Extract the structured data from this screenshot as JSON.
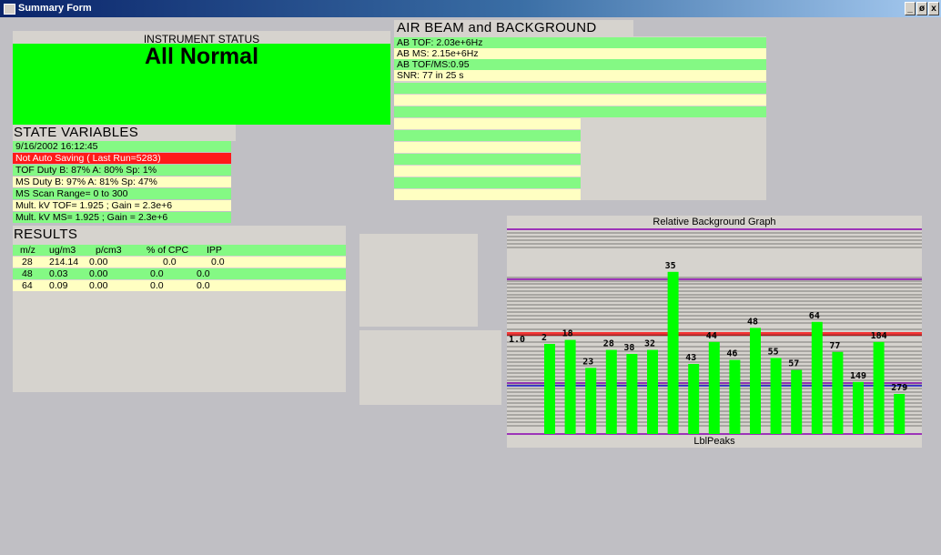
{
  "window": {
    "title": "Summary Form",
    "controls": [
      "_",
      "ø",
      "x"
    ]
  },
  "instrument_status": {
    "heading": "INSTRUMENT STATUS",
    "value": "All Normal",
    "color": "#00ff00"
  },
  "state_variables": {
    "heading": "STATE VARIABLES",
    "rows": [
      "9/16/2002 16:12:45",
      "Not Auto Saving ( Last Run=5283)",
      "TOF Duty B: 87% A: 80% Sp: 1%",
      "MS Duty B:  97% A: 81% Sp: 47%",
      "MS Scan Range= 0 to 300",
      "Mult. kV TOF= 1.925 ; Gain = 2.3e+6",
      "Mult. kV MS= 1.925 ; Gain = 2.3e+6"
    ]
  },
  "results": {
    "heading": "RESULTS",
    "columns": [
      "m/z",
      "ug/m3",
      "p/cm3",
      "% of CPC",
      "IPP"
    ],
    "rows": [
      [
        "28",
        "214.14",
        "0.00",
        "0.0",
        "0.0"
      ],
      [
        "48",
        "0.03",
        "0.00",
        "0.0",
        "0.0"
      ],
      [
        "64",
        "0.09",
        "0.00",
        "0.0",
        "0.0"
      ]
    ]
  },
  "air_beam": {
    "heading": "AIR BEAM and BACKGROUND",
    "rows": [
      "AB TOF: 2.03e+6Hz",
      "AB MS:  2.15e+6Hz",
      "AB TOF/MS:0.95",
      "SNR: 77 in 25 s",
      "",
      "",
      "",
      "",
      "",
      "",
      "",
      "",
      "",
      ""
    ]
  },
  "graph": {
    "title": "Relative Background Graph",
    "footer": "LblPeaks",
    "bar_color": "#00ff00",
    "labels": [
      "1.0",
      "2",
      "18",
      "23",
      "28",
      "38",
      "32",
      "35",
      "43",
      "44",
      "46",
      "48",
      "55",
      "57",
      "64",
      "77",
      "149",
      "184",
      "279"
    ]
  },
  "chart_data": {
    "type": "bar",
    "title": "Relative Background Graph",
    "categories": [
      "2",
      "18",
      "23",
      "28",
      "38",
      "32",
      "35",
      "43",
      "44",
      "46",
      "48",
      "55",
      "57",
      "64",
      "77",
      "149",
      "184",
      "279"
    ],
    "values": [
      0.45,
      0.47,
      0.33,
      0.42,
      0.4,
      0.42,
      0.81,
      0.35,
      0.46,
      0.37,
      0.53,
      0.38,
      0.32,
      0.56,
      0.41,
      0.26,
      0.46,
      0.2
    ],
    "reference_label": "1.0",
    "ylim": [
      0,
      1.0
    ],
    "grid": true
  }
}
